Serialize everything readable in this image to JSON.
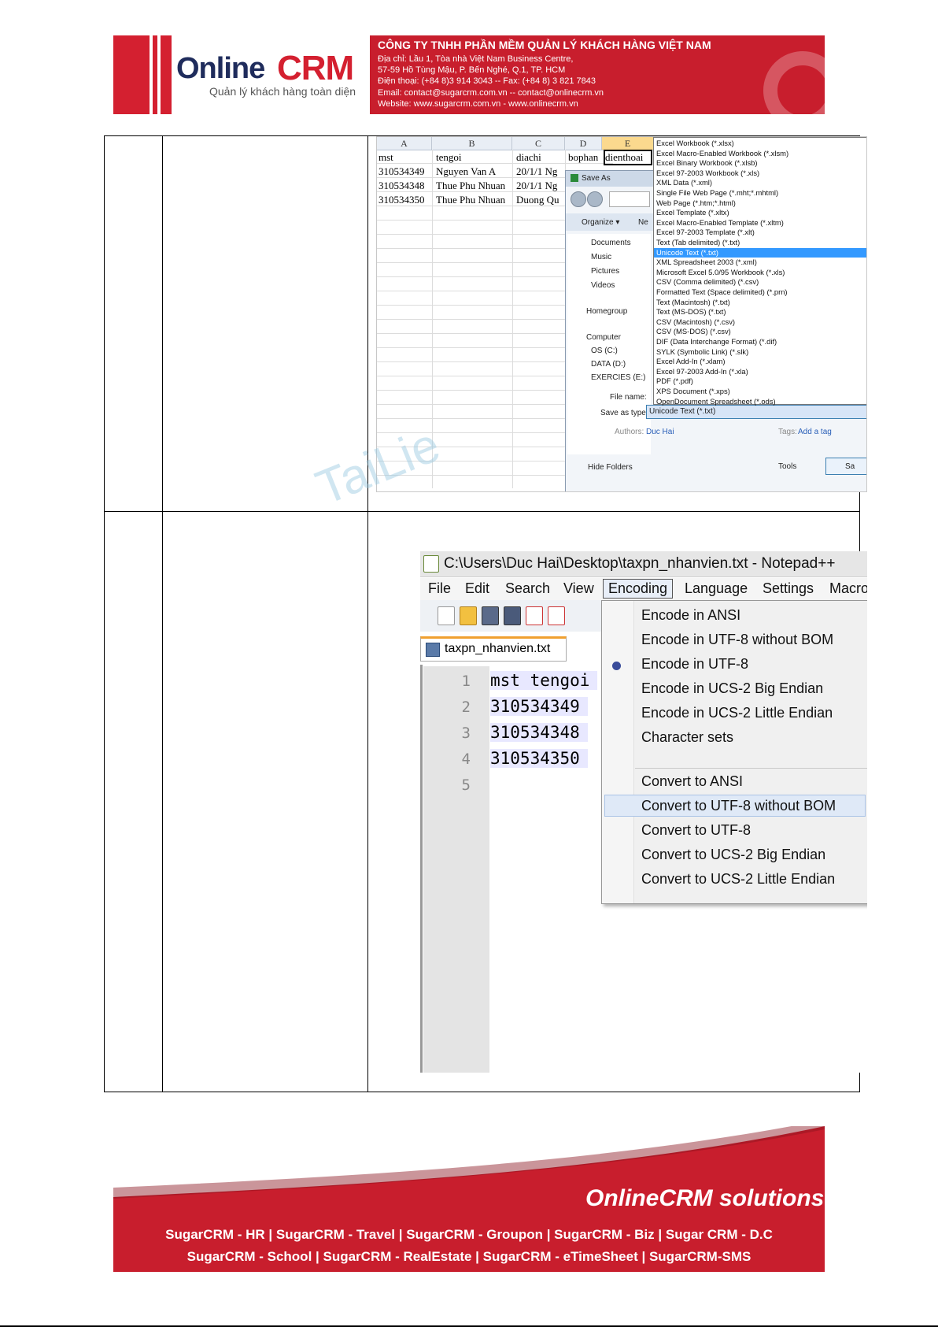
{
  "header": {
    "logo_online": "Online",
    "logo_crm": "CRM",
    "logo_tagline": "Quản lý khách hàng toàn diện",
    "company_name": "CÔNG TY TNHH PHẦN MỀM QUẢN LÝ KHÁCH HÀNG VIỆT NAM",
    "address_1": "Địa chỉ: Lầu 1, Tòa nhà Việt Nam Business Centre,",
    "address_2": "57-59 Hồ Tùng Mậu, P. Bến Nghé, Q.1, TP. HCM",
    "phone": "Điện thoại: (+84 8)3 914 3043 -- Fax: (+84 8) 3 821 7843",
    "email": "Email: contact@sugarcrm.com.vn -- contact@onlinecrm.vn",
    "website": "Website: www.sugarcrm.com.vn - www.onlinecrm.vn"
  },
  "excel": {
    "columns": [
      "A",
      "B",
      "C",
      "D",
      "E"
    ],
    "headers": [
      "mst",
      "tengoi",
      "diachi",
      "bophan",
      "dienthoai"
    ],
    "rows": [
      [
        "310534349",
        "Nguyen Van A",
        "20/1/1 Ng"
      ],
      [
        "310534348",
        "Thue Phu Nhuan",
        "20/1/1 Ng"
      ],
      [
        "310534350",
        "Thue Phu Nhuan",
        "Duong Qu"
      ]
    ],
    "save_dialog": {
      "title": "Save As",
      "organize": "Organize ▾",
      "new_folder": "Ne",
      "nav_items": [
        "Documents",
        "Music",
        "Pictures",
        "Videos",
        "Homegroup",
        "Computer",
        "OS (C:)",
        "DATA (D:)",
        "EXERCIES (E:)"
      ],
      "file_name_label": "File name:",
      "save_as_type_label": "Save as type:",
      "save_as_type_value": "Unicode Text (*.txt)",
      "authors_label": "Authors:",
      "authors_value": "Duc Hai",
      "tags_label": "Tags:",
      "tags_value": "Add a tag",
      "hide_folders": "Hide Folders",
      "tools": "Tools",
      "save_button": "Sa"
    },
    "file_types": [
      "Excel Workbook (*.xlsx)",
      "Excel Macro-Enabled Workbook (*.xlsm)",
      "Excel Binary Workbook (*.xlsb)",
      "Excel 97-2003 Workbook (*.xls)",
      "XML Data (*.xml)",
      "Single File Web Page (*.mht;*.mhtml)",
      "Web Page (*.htm;*.html)",
      "Excel Template (*.xltx)",
      "Excel Macro-Enabled Template (*.xltm)",
      "Excel 97-2003 Template (*.xlt)",
      "Text (Tab delimited) (*.txt)",
      "Unicode Text (*.txt)",
      "XML Spreadsheet 2003 (*.xml)",
      "Microsoft Excel 5.0/95 Workbook (*.xls)",
      "CSV (Comma delimited) (*.csv)",
      "Formatted Text (Space delimited) (*.prn)",
      "Text (Macintosh) (*.txt)",
      "Text (MS-DOS) (*.txt)",
      "CSV (Macintosh) (*.csv)",
      "CSV (MS-DOS) (*.csv)",
      "DIF (Data Interchange Format) (*.dif)",
      "SYLK (Symbolic Link) (*.slk)",
      "Excel Add-In (*.xlam)",
      "Excel 97-2003 Add-In (*.xla)",
      "PDF (*.pdf)",
      "XPS Document (*.xps)",
      "OpenDocument Spreadsheet (*.ods)"
    ],
    "selected_file_type_index": 11
  },
  "watermark": "TaiLie",
  "notepad": {
    "title": "C:\\Users\\Duc Hai\\Desktop\\taxpn_nhanvien.txt - Notepad++",
    "menu": [
      "File",
      "Edit",
      "Search",
      "View",
      "Encoding",
      "Language",
      "Settings",
      "Macro"
    ],
    "active_menu": "Encoding",
    "tab": "taxpn_nhanvien.txt",
    "line_numbers": [
      "1",
      "2",
      "3",
      "4",
      "5"
    ],
    "lines": [
      "mst tengoi",
      "310534349",
      "310534348",
      "310534350",
      ""
    ],
    "encoding_items": [
      "Encode in ANSI",
      "Encode in UTF-8 without BOM",
      "Encode in UTF-8",
      "Encode in UCS-2 Big Endian",
      "Encode in UCS-2 Little Endian",
      "Character sets"
    ],
    "convert_items": [
      "Convert to ANSI",
      "Convert to UTF-8 without BOM",
      "Convert to UTF-8",
      "Convert to UCS-2 Big Endian",
      "Convert to UCS-2 Little Endian"
    ],
    "checked_item": "Encode in UTF-8",
    "highlighted_item": "Convert to UTF-8 without BOM"
  },
  "footer": {
    "brand": "OnlineCRM solutions",
    "line_1": "SugarCRM - HR  |  SugarCRM - Travel  |  SugarCRM - Groupon  |  SugarCRM - Biz  |  Sugar CRM - D.C",
    "line_2": "SugarCRM - School  |  SugarCRM - RealEstate  |  SugarCRM - eTimeSheet  |  SugarCRM-SMS"
  },
  "colors": {
    "brand_red": "#d42030",
    "brand_navy": "#1f2c5c",
    "selection_blue": "#3399ff"
  }
}
